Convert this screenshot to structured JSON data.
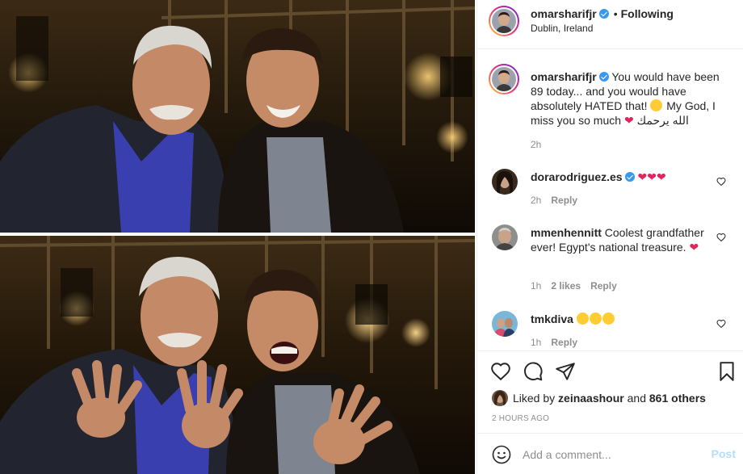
{
  "header": {
    "username": "omarsharifjr",
    "separator": "•",
    "follow_status": "Following",
    "location": "Dublin, Ireland"
  },
  "caption": {
    "username": "omarsharifjr",
    "text_part1": "You would have been 89 today... and you would have absolutely HATED that!",
    "text_part2": "My God, I miss you so much",
    "arabic_text": "الله يرحمك",
    "time": "2h"
  },
  "comments": [
    {
      "username": "dorarodriguez.es",
      "text": "",
      "time": "2h",
      "reply_label": "Reply",
      "likes": ""
    },
    {
      "username": "mmenhennitt",
      "text": "Coolest grandfather ever! Egypt's national treasure.",
      "time": "1h",
      "likes": "2 likes",
      "reply_label": "Reply"
    },
    {
      "username": "tmkdiva",
      "text": "",
      "time": "1h",
      "reply_label": "Reply",
      "likes": ""
    }
  ],
  "actions": {
    "liked_by_prefix": "Liked by",
    "liked_by_user": "zeinaashour",
    "liked_by_middle": "and",
    "others": "861 others",
    "time_ago": "2 HOURS AGO"
  },
  "composer": {
    "placeholder": "Add a comment...",
    "post_label": "Post"
  },
  "colors": {
    "verified": "#3897f0",
    "heart": "#e0245e",
    "muted": "#8e8e8e",
    "post_disabled": "#b2dffc"
  },
  "icons": [
    "heart-icon",
    "comment-icon",
    "share-icon",
    "save-icon",
    "smile-icon",
    "verified-badge-icon"
  ]
}
